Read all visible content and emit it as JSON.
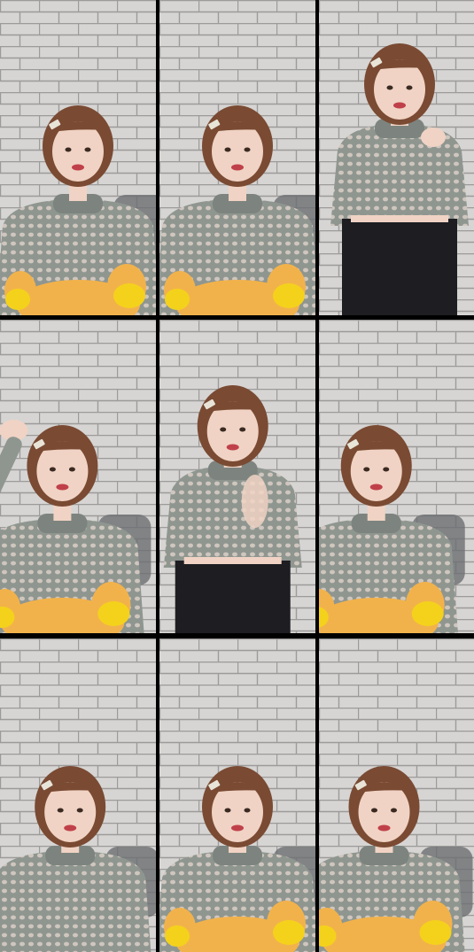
{
  "grid": {
    "rows": 3,
    "cols": 3,
    "frames": [
      {
        "label": "",
        "pose": "seated-smile",
        "plush": true,
        "skirt": false,
        "hand": "none"
      },
      {
        "label": "",
        "pose": "seated-grin",
        "plush": true,
        "skirt": false,
        "hand": "none"
      },
      {
        "label": "",
        "pose": "standing-wave",
        "plush": false,
        "skirt": true,
        "hand": "chest"
      },
      {
        "label": "",
        "pose": "seated-hand-raised",
        "plush": true,
        "skirt": false,
        "hand": "raised"
      },
      {
        "label": "",
        "pose": "standing-clap",
        "plush": false,
        "skirt": true,
        "hand": "clap"
      },
      {
        "label": "",
        "pose": "seated-talking",
        "plush": true,
        "skirt": false,
        "hand": "none"
      },
      {
        "label": "",
        "pose": "seated-lower",
        "plush": false,
        "skirt": false,
        "hand": "none"
      },
      {
        "label": "",
        "pose": "seated-lower",
        "plush": true,
        "skirt": false,
        "hand": "none"
      },
      {
        "label": "",
        "pose": "seated-lower",
        "plush": true,
        "skirt": false,
        "hand": "none"
      }
    ]
  },
  "colors": {
    "wall": "#d6d5d3",
    "brick_line": "#9c9b99",
    "sweater": "#8f9690",
    "skin": "#f0d3c4",
    "hair": "#7a4a33",
    "plush": "#f2b24b",
    "plush_tip": "#f4d21c",
    "skirt": "#1d1d22"
  }
}
